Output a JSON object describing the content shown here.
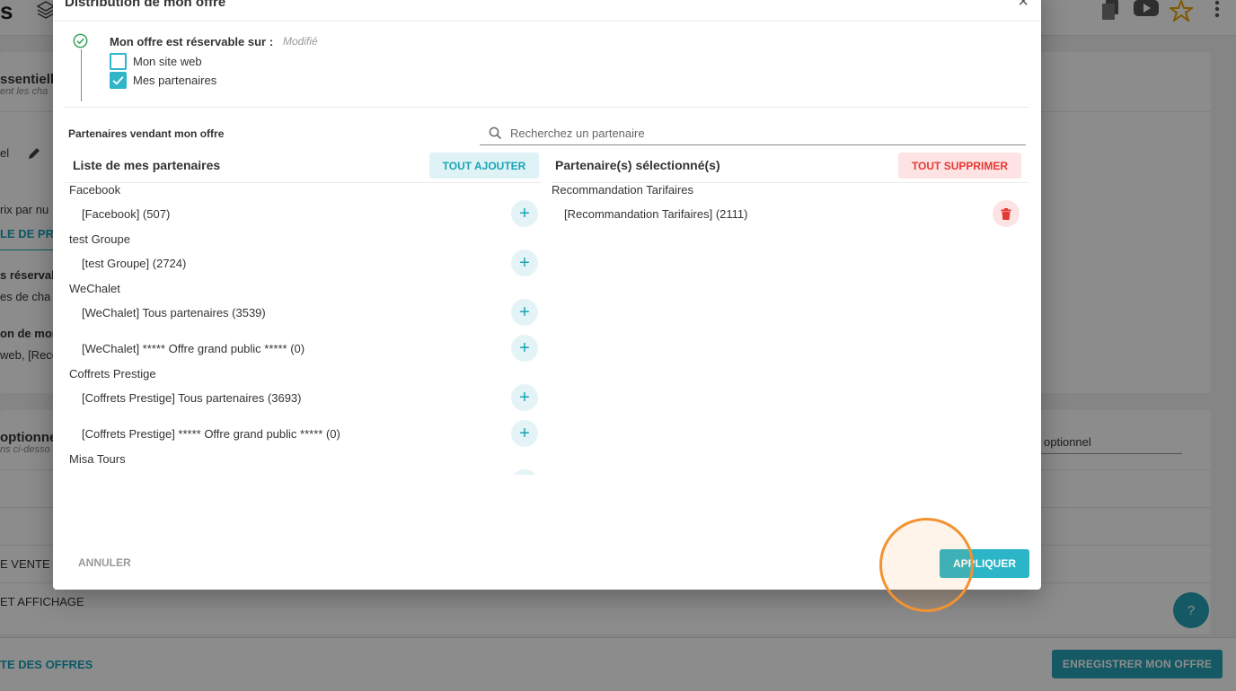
{
  "background": {
    "app_title_fragment": "s",
    "section_essential": "ssentielle",
    "section_essential_sub": "ent les cha",
    "field_fragment": "el",
    "price_fragment": "rix par nu",
    "price_link_fragment": "LE DE PRI",
    "bookable_fragment": "s réservab",
    "bookable_sub_fragment": "es de cha",
    "distrib_fragment": "on de mor",
    "distrib_value_fragment": "web, [Reco",
    "optional_fragment": "optionnel",
    "optional_sub_fragment": "ns ci-desso",
    "optional_input_fragment": "optionnel",
    "sale_fragment": "E VENTE E",
    "display_fragment": "ET AFFICHAGE",
    "offers_link_fragment": "TE DES OFFRES",
    "save_offer_button": "ENREGISTRER MON OFFRE",
    "help_label": "?"
  },
  "modal": {
    "title": "Distribution de mon offre",
    "close_label": "×",
    "bookable_label": "Mon offre est réservable sur :",
    "modified_label": "Modifié",
    "options": [
      {
        "label": "Mon site web",
        "checked": false
      },
      {
        "label": "Mes partenaires",
        "checked": true
      }
    ],
    "partners_title": "Partenaires vendant mon offre",
    "search_placeholder": "Recherchez un partenaire",
    "left_column": {
      "title": "Liste de mes partenaires",
      "add_all_label": "TOUT AJOUTER",
      "groups": [
        {
          "name": "Facebook",
          "items": [
            "[Facebook] (507)"
          ]
        },
        {
          "name": "test Groupe",
          "items": [
            "[test Groupe] (2724)"
          ]
        },
        {
          "name": "WeChalet",
          "items": [
            "[WeChalet] Tous partenaires (3539)",
            "[WeChalet] ***** Offre grand public ***** (0)"
          ]
        },
        {
          "name": "Coffrets Prestige",
          "items": [
            "[Coffrets Prestige] Tous partenaires (3693)",
            "[Coffrets Prestige] ***** Offre grand public ***** (0)"
          ]
        },
        {
          "name": "Misa Tours",
          "items": [
            ""
          ]
        }
      ]
    },
    "right_column": {
      "title": "Partenaire(s) sélectionné(s)",
      "delete_all_label": "TOUT SUPPRIMER",
      "groups": [
        {
          "name": "Recommandation Tarifaires",
          "items": [
            "[Recommandation Tarifaires] (2111)"
          ]
        }
      ]
    },
    "cancel_label": "ANNULER",
    "apply_label": "APPLIQUER"
  },
  "colors": {
    "accent": "#2bb5c6",
    "danger": "#e53935",
    "click_indicator": "#f39233"
  }
}
